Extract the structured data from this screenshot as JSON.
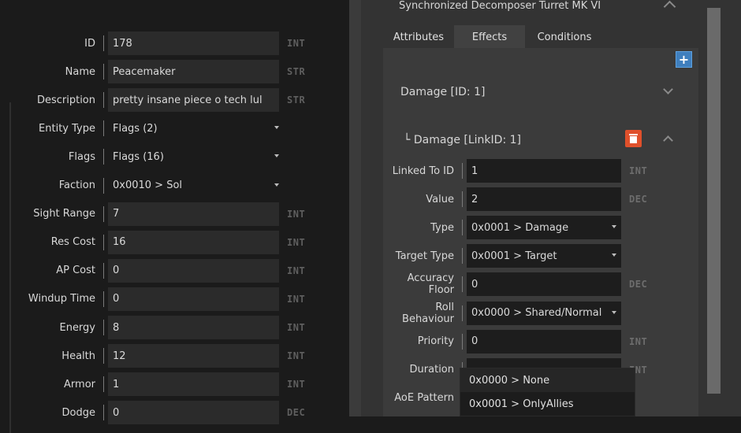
{
  "entity_fields": [
    {
      "label": "ID",
      "value": "178",
      "type": "INT",
      "kind": "input"
    },
    {
      "label": "Name",
      "value": "Peacemaker",
      "type": "STR",
      "kind": "input"
    },
    {
      "label": "Description",
      "value": "pretty insane piece o tech lul",
      "type": "STR",
      "kind": "input"
    },
    {
      "label": "Entity Type",
      "value": "Flags (2)",
      "type": "",
      "kind": "select"
    },
    {
      "label": "Flags",
      "value": "Flags (16)",
      "type": "",
      "kind": "select"
    },
    {
      "label": "Faction",
      "value": "0x0010 > Sol",
      "type": "",
      "kind": "select"
    },
    {
      "label": "Sight Range",
      "value": "7",
      "type": "INT",
      "kind": "input"
    },
    {
      "label": "Res Cost",
      "value": "16",
      "type": "INT",
      "kind": "input"
    },
    {
      "label": "AP Cost",
      "value": "0",
      "type": "INT",
      "kind": "input"
    },
    {
      "label": "Windup Time",
      "value": "0",
      "type": "INT",
      "kind": "input"
    },
    {
      "label": "Energy",
      "value": "8",
      "type": "INT",
      "kind": "input"
    },
    {
      "label": "Health",
      "value": "12",
      "type": "INT",
      "kind": "input"
    },
    {
      "label": "Armor",
      "value": "1",
      "type": "INT",
      "kind": "input"
    },
    {
      "label": "Dodge",
      "value": "0",
      "type": "DEC",
      "kind": "input"
    }
  ],
  "right_panel": {
    "title": "Synchronized Decomposer Turret MK VI",
    "tabs": [
      {
        "label": "Attributes",
        "active": false
      },
      {
        "label": "Effects",
        "active": true
      },
      {
        "label": "Conditions",
        "active": false
      }
    ],
    "add_label": "+",
    "damage_header": "Damage [ID: 1]",
    "link_header": "└ Damage [LinkID: 1]",
    "effect_fields": [
      {
        "label": "Linked To ID",
        "value": "1",
        "type": "INT",
        "kind": "input"
      },
      {
        "label": "Value",
        "value": "2",
        "type": "DEC",
        "kind": "input"
      },
      {
        "label": "Type",
        "value": "0x0001 > Damage",
        "type": "",
        "kind": "select"
      },
      {
        "label": "Target Type",
        "value": "0x0001 > Target",
        "type": "",
        "kind": "select"
      },
      {
        "label": "Accuracy Floor",
        "value": "0",
        "type": "DEC",
        "kind": "input"
      },
      {
        "label": "Roll Behaviour",
        "value": "0x0000 > Shared/Normal",
        "type": "",
        "kind": "select"
      },
      {
        "label": "Priority",
        "value": "0",
        "type": "INT",
        "kind": "input"
      },
      {
        "label": "Duration",
        "value": "",
        "type": "INT",
        "kind": "input"
      },
      {
        "label": "AoE Pattern",
        "value": "",
        "type": "",
        "kind": "select"
      }
    ],
    "dropdown_options": [
      "0x0000 > None",
      "0x0001 > OnlyAllies"
    ]
  }
}
